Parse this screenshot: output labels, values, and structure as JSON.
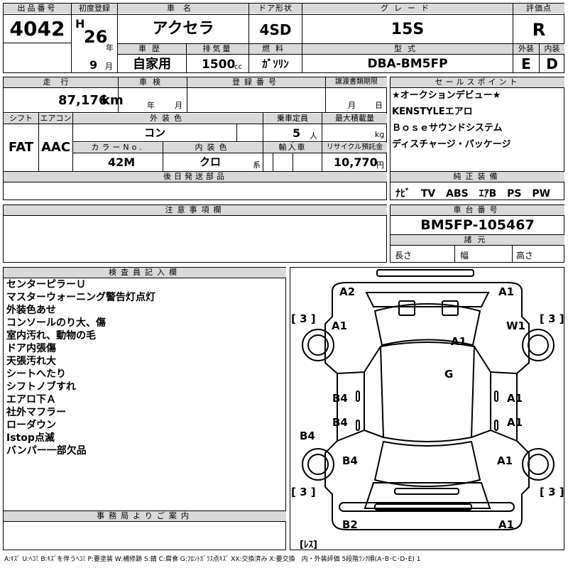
{
  "headers": {
    "lot_no": "出品番号",
    "first_reg": "初度登録",
    "car_name": "車名",
    "door": "ドア形状",
    "grade": "グレード",
    "score": "評価点",
    "history": "車歴",
    "displacement": "排気量",
    "fuel": "燃料",
    "model": "型式",
    "exterior": "外装",
    "interior": "内装",
    "mileage": "走行",
    "inspection": "車検",
    "reg_no": "登録番号",
    "transfer_deadline": "譲渡書類期限",
    "sales_points": "セールスポイント",
    "shift": "シフト",
    "aircon": "エアコン",
    "ext_color": "外装色",
    "capacity": "乗車定員",
    "max_load": "最大積載量",
    "color_no": "カラーNo.",
    "int_color": "内装色",
    "import": "輸入車",
    "recycle": "リサイクル預託金",
    "later_parts": "後日発送部品",
    "equipment": "純正装備",
    "notes": "注意事項欄",
    "chassis": "車台番号",
    "dimensions": "諸元",
    "inspector": "検査員記入欄",
    "office": "事務局よりご案内"
  },
  "vehicle": {
    "lot_no": "4042",
    "era": "H",
    "year": "26",
    "year_unit": "年",
    "month": "9",
    "month_unit": "月",
    "name": "アクセラ",
    "door": "4SD",
    "grade": "15S",
    "score": "R",
    "history": "自家用",
    "displacement": "1500",
    "displacement_unit": "cc",
    "fuel": "ｶﾞｿﾘﾝ",
    "model": "DBA-BM5FP",
    "exterior": "E",
    "interior": "D",
    "mileage": "87,176",
    "mileage_unit": "km",
    "inspection_year_unit": "年",
    "inspection_month_unit": "月",
    "deadline_month_unit": "月",
    "deadline_day_unit": "日",
    "shift": "FAT",
    "aircon": "AAC",
    "ext_color": "コン",
    "capacity": "5",
    "capacity_unit": "人",
    "load_unit": "kg",
    "color_no": "42M",
    "int_color": "クロ",
    "int_color_suffix": "系",
    "recycle": "10,770",
    "recycle_unit": "円",
    "chassis_no": "BM5FP-105467",
    "length_label": "長さ",
    "width_label": "幅",
    "height_label": "高さ"
  },
  "sales_points": [
    "★オークションデビュー★",
    "KENSTYLEエアロ",
    "Ｂｏｓｅサウンドシステム",
    "ディスチャージ・パッケージ"
  ],
  "equipment": [
    "ﾅﾋﾞ",
    "TV",
    "ABS",
    "ｴｱB",
    "PS",
    "PW"
  ],
  "inspector_notes": [
    "センターピラーＵ",
    "マスターウォーニング警告灯点灯",
    "外装色あせ",
    "コンソールのり大、傷",
    "室内汚れ、動物の毛",
    "ドア内張傷",
    "天張汚れ大",
    "シートへたり",
    "シフトノブすれ",
    "エアロ下Ａ",
    "社外マフラー",
    "ローダウン",
    "Istop点滅",
    "バンパー一部欠品"
  ],
  "diagram": {
    "tread_labels": [
      "[ 3 ]",
      "[ 3 ]",
      "[ 3 ]",
      "[ 3 ]"
    ],
    "spare_label": "[ﾚｽ]",
    "marks": {
      "front_left": "A2",
      "front_right": "A1",
      "fender_left": "A1",
      "fender_right": "W1",
      "hood": "A1",
      "roof": "G",
      "front_door_left": "B4",
      "front_door_right": "A1",
      "rear_door_left": "B4",
      "rear_door_right": "A1",
      "rocker_left": "B4",
      "rear_fender_left": "B4",
      "rear_fender_right": "A1",
      "rear_left": "B2",
      "rear_right": "A1"
    }
  },
  "legend": "A:ｷｽﾞ U:ﾍｺﾐ B:ｷｽﾞを伴うﾍｺﾐ P:要塗装 W:補修跡 S:錆 C:腐食 G:ﾌﾛﾝﾄｶﾞﾗｽ点ｷｽﾞ XX:交換済み X:要交換　内・外装評価 5段階ﾗﾝｸ順(A･B･C･D･E) 1"
}
